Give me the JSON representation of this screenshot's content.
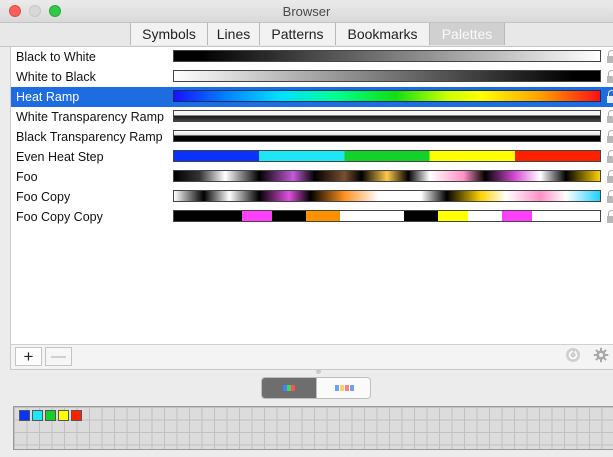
{
  "window": {
    "title": "Browser"
  },
  "tabs": [
    {
      "label": "Symbols",
      "active": false
    },
    {
      "label": "Lines",
      "active": false
    },
    {
      "label": "Patterns",
      "active": false
    },
    {
      "label": "Bookmarks",
      "active": false
    },
    {
      "label": "Palettes",
      "active": true
    }
  ],
  "palettes": [
    {
      "name": "Black to White",
      "selected": false,
      "locked": true
    },
    {
      "name": "White to Black",
      "selected": false,
      "locked": true
    },
    {
      "name": "Heat Ramp",
      "selected": true,
      "locked": true
    },
    {
      "name": "White Transparency Ramp",
      "selected": false,
      "locked": true
    },
    {
      "name": "Black Transparency Ramp",
      "selected": false,
      "locked": true
    },
    {
      "name": "Even Heat Step",
      "selected": false,
      "locked": true
    },
    {
      "name": "Foo",
      "selected": false,
      "locked": true
    },
    {
      "name": "Foo Copy",
      "selected": false,
      "locked": true
    },
    {
      "name": "Foo Copy Copy",
      "selected": false,
      "locked": true
    }
  ],
  "footer": {
    "add_label": "+",
    "remove_label": "—",
    "refresh_icon": "refresh-icon",
    "gear_icon": "gear-icon"
  },
  "swatches": [
    "#0a32ff",
    "#1ee6f5",
    "#12d22a",
    "#ffff00",
    "#ff2000"
  ],
  "colors": {
    "selection": "#1d6ce0"
  }
}
